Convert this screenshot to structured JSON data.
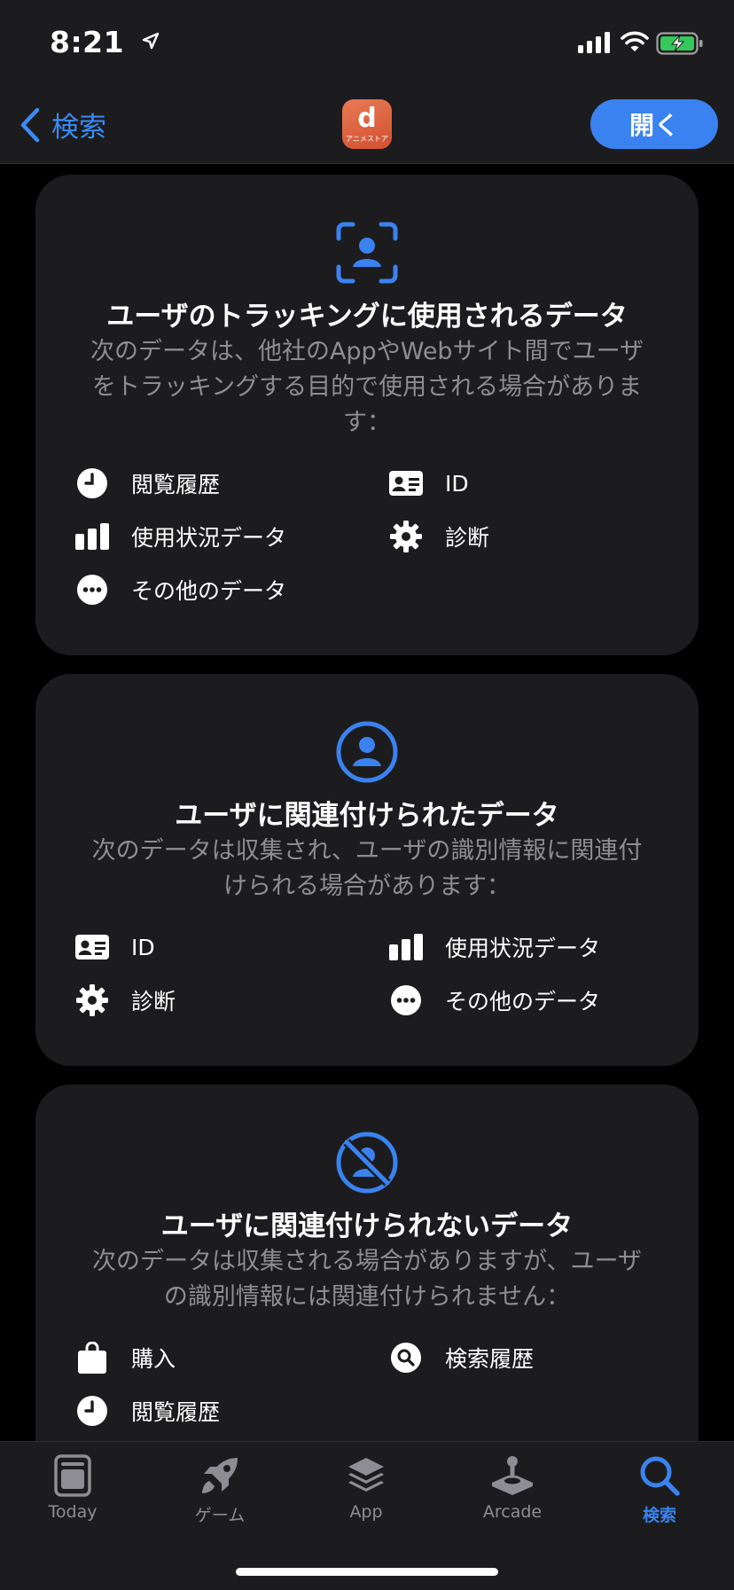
{
  "status_bar": {
    "time": "8:21"
  },
  "nav": {
    "back_label": "検索",
    "app_icon_letter": "d",
    "app_icon_sub": "アニメストア",
    "open_label": "開く"
  },
  "cards": [
    {
      "title": "ユーザのトラッキングに使用されるデータ",
      "desc_lines": [
        "次のデータは、他社のAppやWebサイト間でユーザ",
        "をトラッキングする目的で使用される場合がありま",
        "す："
      ],
      "items": [
        "閲覧履歴",
        "ID",
        "使用状況データ",
        "診断",
        "その他のデータ"
      ]
    },
    {
      "title": "ユーザに関連付けられたデータ",
      "desc_lines": [
        "次のデータは収集され、ユーザの識別情報に関連付",
        "けられる場合があります："
      ],
      "items": [
        "ID",
        "使用状況データ",
        "診断",
        "その他のデータ"
      ]
    },
    {
      "title": "ユーザに関連付けられないデータ",
      "desc_lines": [
        "次のデータは収集される場合がありますが、ユーザ",
        "の識別情報には関連付けられません："
      ],
      "items": [
        "購入",
        "検索履歴",
        "閲覧履歴"
      ]
    }
  ],
  "tabs": [
    {
      "label": "Today",
      "icon": "today-icon"
    },
    {
      "label": "ゲーム",
      "icon": "rocket-icon"
    },
    {
      "label": "App",
      "icon": "layers-icon"
    },
    {
      "label": "Arcade",
      "icon": "joystick-icon"
    },
    {
      "label": "検索",
      "icon": "search-icon",
      "active": true
    }
  ],
  "colors": {
    "accent": "#3a82f0",
    "card_bg": "#1c1c1e",
    "secondary_text": "#8d8d93"
  }
}
